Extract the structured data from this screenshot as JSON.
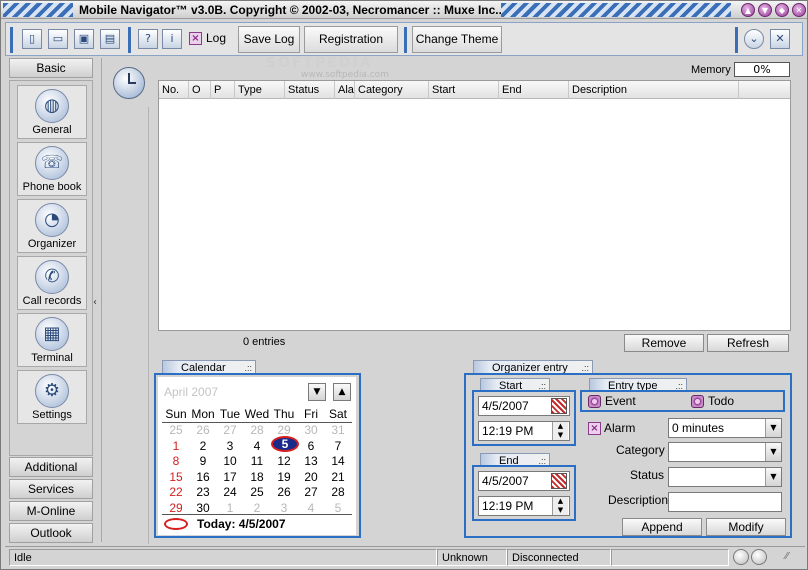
{
  "window": {
    "title": "Mobile Navigator™ v3.0B. Copyright © 2002-03, Necromancer :: Muxe Inc..."
  },
  "toolbar": {
    "log_label": "Log",
    "save_log_label": "Save Log",
    "registration_label": "Registration",
    "change_theme_label": "Change Theme"
  },
  "sidebar": {
    "basic_tab": "Basic",
    "items": [
      {
        "label": "General",
        "icon": "globe-icon"
      },
      {
        "label": "Phone book",
        "icon": "phone-icon"
      },
      {
        "label": "Organizer",
        "icon": "clock-icon"
      },
      {
        "label": "Call records",
        "icon": "call-records-icon"
      },
      {
        "label": "Terminal",
        "icon": "terminal-icon"
      },
      {
        "label": "Settings",
        "icon": "gears-icon"
      }
    ],
    "bottom_tabs": [
      "Additional",
      "Services",
      "M-Online",
      "Outlook"
    ]
  },
  "memory": {
    "label": "Memory",
    "value": "0%"
  },
  "grid": {
    "columns": [
      "No.",
      "O",
      "P",
      "Type",
      "Status",
      "Alarm",
      "Category",
      "Start",
      "End",
      "Description"
    ],
    "footer": "0 entries",
    "remove_label": "Remove",
    "refresh_label": "Refresh"
  },
  "calendar": {
    "tab_label": "Calendar",
    "month_label": "April 2007",
    "weekdays": [
      "Sun",
      "Mon",
      "Tue",
      "Wed",
      "Thu",
      "Fri",
      "Sat"
    ],
    "weeks": [
      [
        "25",
        "26",
        "27",
        "28",
        "29",
        "30",
        "31"
      ],
      [
        "1",
        "2",
        "3",
        "4",
        "5",
        "6",
        "7"
      ],
      [
        "8",
        "9",
        "10",
        "11",
        "12",
        "13",
        "14"
      ],
      [
        "15",
        "16",
        "17",
        "18",
        "19",
        "20",
        "21"
      ],
      [
        "22",
        "23",
        "24",
        "25",
        "26",
        "27",
        "28"
      ],
      [
        "29",
        "30",
        "1",
        "2",
        "3",
        "4",
        "5"
      ]
    ],
    "selected_day": "5",
    "today_label": "Today: 4/5/2007"
  },
  "organizer": {
    "tab_label": "Organizer entry",
    "start": {
      "label": "Start",
      "date": "4/5/2007",
      "time": "12:19 PM"
    },
    "end": {
      "label": "End",
      "date": "4/5/2007",
      "time": "12:19 PM"
    },
    "entry_type": {
      "label": "Entry type",
      "event": "Event",
      "todo": "Todo"
    },
    "alarm": {
      "label": "Alarm",
      "value": "0 minutes"
    },
    "category_label": "Category",
    "status_label": "Status",
    "description_label": "Description",
    "append_label": "Append",
    "modify_label": "Modify"
  },
  "statusbar": {
    "state": "Idle",
    "phone": "Unknown",
    "connection": "Disconnected"
  },
  "watermark": "www.softpedia.com",
  "watermark_large": "SOFTPEDIA",
  "colors": {
    "accent_blue": "#2b6fc4",
    "weekend_red": "#d42020",
    "selected_day_bg": "#1a2a8a"
  }
}
